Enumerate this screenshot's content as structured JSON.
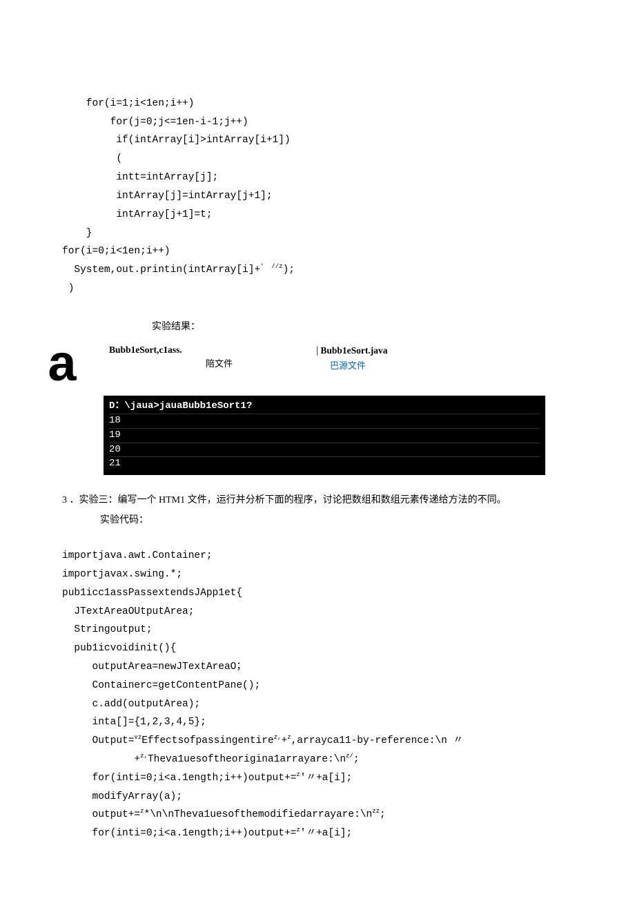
{
  "code_block_1": {
    "l1": "    for(i=1;i<1en;i++)",
    "l2": "        for(j=0;j<=1en-i-1;j++)",
    "l3": "         if(intArray[i]>intArray[i+1])",
    "l4": "         (",
    "l5": "         intt=intArray[j];",
    "l6": "         intArray[j]=intArray[j+1];",
    "l7": "         intArray[j+1]=t;",
    "l8": "    }",
    "l9": "for(i=0;i<1en;i++)",
    "l10_a": "  System,out.printin(intArray[i]+",
    "l10_b": "'  //z",
    "l10_c": ");",
    "l11": " )"
  },
  "result_label": "实验结果：",
  "letter_a": "a",
  "files": {
    "file1_name": "Bubb1eSort,c1ass.",
    "file1_type": "陪文件",
    "file2_bar": "|",
    "file2_name": "Bubb1eSort.java",
    "file2_type": "巴源文件"
  },
  "console": {
    "cmd": "D：\\jaua>jauaBubb1eSort1?",
    "r1": "18",
    "r2": "19",
    "r3": "20",
    "r4": "21"
  },
  "section3": {
    "heading": "3 ．实验三：编写一个 HTM1 文件，运行并分析下面的程序，讨论把数组和数组元素传递给方法的不同。",
    "label": "实验代码："
  },
  "code_block_2": {
    "l1": "importjava.awt.Container;",
    "l2": "importjavax.swing.*;",
    "l3": "pub1icc1assPassextendsJApp1et{",
    "l4": "  JTextAreaOUtputArea;",
    "l5": "  Stringoutput;",
    "l6": "  pub1icvoidinit(){",
    "l7": "     outputArea=newJTextAreaO；",
    "l8": "     Containerc=getContentPane();",
    "l9": "     c.add(outputArea);",
    "l10": "     inta[]={1,2,3,4,5};",
    "l11_a": "     Output=",
    "l11_b": "vz",
    "l11_c": "Effectsofpassingentire",
    "l11_d": "z,",
    "l11_e": "+",
    "l11_f": "z",
    "l11_g": ",arrayca11-by-reference:\\n 〃",
    "l12_a": "            +",
    "l12_b": "z,",
    "l12_c": "Theva1uesoftheorigina1arrayare:\\n",
    "l12_d": "z/",
    "l12_e": ";",
    "l13_a": "     for(inti=0;i<a.1ength;i++)output+=",
    "l13_b": "z",
    "l13_c": "'〃+a[i];",
    "l14": "     modifyArray(a);",
    "l15_a": "     output+=",
    "l15_b": "z",
    "l15_c": "*\\n\\nTheva1uesofthemodifiedarrayare:\\n",
    "l15_d": "zz",
    "l15_e": ";",
    "l16_a": "     for(inti=0;i<a.1ength;i++)output+=",
    "l16_b": "z",
    "l16_c": "'〃+a[i];"
  }
}
